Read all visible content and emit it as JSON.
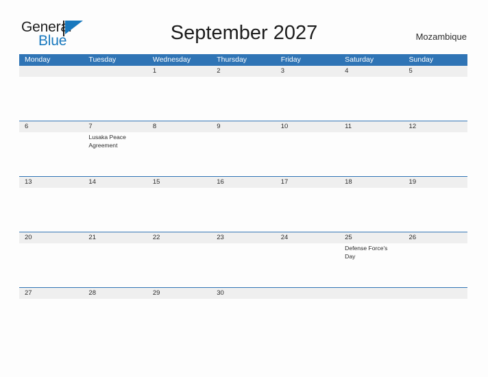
{
  "brand": {
    "word_one": "General",
    "word_two": "Blue",
    "flag_icon": "triangle-flag-icon",
    "accent_color": "#1878be"
  },
  "header": {
    "title": "September 2027",
    "country": "Mozambique"
  },
  "colors": {
    "header_blue": "#2f74b5",
    "row_band_gray": "#efefef",
    "page_background": "#fdfdfd",
    "text": "#2b2b2b"
  },
  "calendar": {
    "weekdays": [
      "Monday",
      "Tuesday",
      "Wednesday",
      "Thursday",
      "Friday",
      "Saturday",
      "Sunday"
    ],
    "weeks": [
      {
        "days": [
          {
            "num": "",
            "event": ""
          },
          {
            "num": "",
            "event": ""
          },
          {
            "num": "1",
            "event": ""
          },
          {
            "num": "2",
            "event": ""
          },
          {
            "num": "3",
            "event": ""
          },
          {
            "num": "4",
            "event": ""
          },
          {
            "num": "5",
            "event": ""
          }
        ]
      },
      {
        "days": [
          {
            "num": "6",
            "event": ""
          },
          {
            "num": "7",
            "event": "Lusaka Peace Agreement"
          },
          {
            "num": "8",
            "event": ""
          },
          {
            "num": "9",
            "event": ""
          },
          {
            "num": "10",
            "event": ""
          },
          {
            "num": "11",
            "event": ""
          },
          {
            "num": "12",
            "event": ""
          }
        ]
      },
      {
        "days": [
          {
            "num": "13",
            "event": ""
          },
          {
            "num": "14",
            "event": ""
          },
          {
            "num": "15",
            "event": ""
          },
          {
            "num": "16",
            "event": ""
          },
          {
            "num": "17",
            "event": ""
          },
          {
            "num": "18",
            "event": ""
          },
          {
            "num": "19",
            "event": ""
          }
        ]
      },
      {
        "days": [
          {
            "num": "20",
            "event": ""
          },
          {
            "num": "21",
            "event": ""
          },
          {
            "num": "22",
            "event": ""
          },
          {
            "num": "23",
            "event": ""
          },
          {
            "num": "24",
            "event": ""
          },
          {
            "num": "25",
            "event": "Defense Force's Day"
          },
          {
            "num": "26",
            "event": ""
          }
        ]
      },
      {
        "days": [
          {
            "num": "27",
            "event": ""
          },
          {
            "num": "28",
            "event": ""
          },
          {
            "num": "29",
            "event": ""
          },
          {
            "num": "30",
            "event": ""
          },
          {
            "num": "",
            "event": ""
          },
          {
            "num": "",
            "event": ""
          },
          {
            "num": "",
            "event": ""
          }
        ]
      }
    ]
  }
}
